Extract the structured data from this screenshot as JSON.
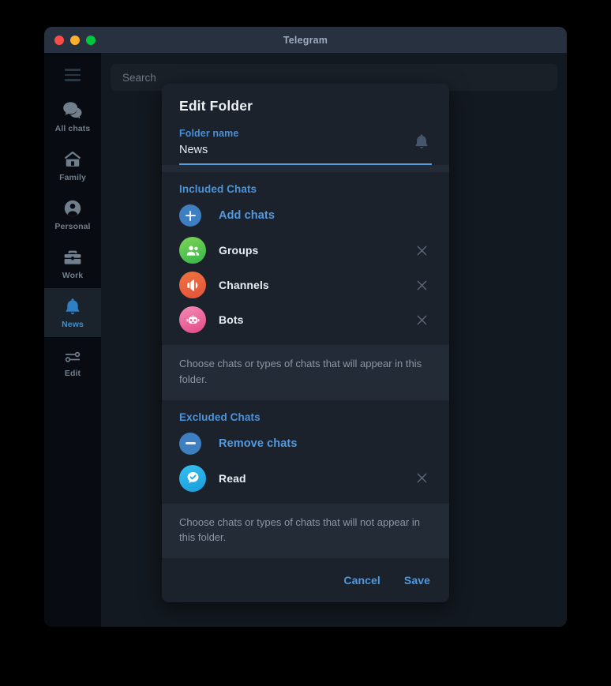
{
  "window": {
    "title": "Telegram",
    "controls": [
      "close",
      "minimize",
      "maximize"
    ]
  },
  "sidebar": {
    "menu_icon": "hamburger-icon",
    "items": [
      {
        "label": "All chats",
        "icon": "chats-icon",
        "active": false
      },
      {
        "label": "Family",
        "icon": "home-icon",
        "active": false
      },
      {
        "label": "Personal",
        "icon": "person-icon",
        "active": false
      },
      {
        "label": "Work",
        "icon": "briefcase-icon",
        "active": false
      },
      {
        "label": "News",
        "icon": "bell-icon",
        "active": true
      },
      {
        "label": "Edit",
        "icon": "sliders-icon",
        "active": false
      }
    ]
  },
  "search": {
    "placeholder": "Search",
    "value": ""
  },
  "dialog": {
    "title": "Edit Folder",
    "folder_name_label": "Folder name",
    "folder_name_value": "News",
    "notification_icon": "bell-icon",
    "included": {
      "section_title": "Included Chats",
      "add_label": "Add chats",
      "add_icon": "plus-icon",
      "chats": [
        {
          "name": "Groups",
          "icon": "group-icon",
          "color": "#4cc05a"
        },
        {
          "name": "Channels",
          "icon": "megaphone-icon",
          "color": "#e85f3c"
        },
        {
          "name": "Bots",
          "icon": "robot-icon",
          "color": "#e8639a"
        }
      ],
      "hint": "Choose chats or types of chats that will appear in this folder."
    },
    "excluded": {
      "section_title": "Excluded Chats",
      "remove_label": "Remove chats",
      "remove_icon": "minus-icon",
      "chats": [
        {
          "name": "Read",
          "icon": "read-check-icon",
          "color": "#23a8e0"
        }
      ],
      "hint": "Choose chats or types of chats that will not appear in this folder."
    },
    "cancel_label": "Cancel",
    "save_label": "Save"
  },
  "colors": {
    "accent": "#4b93da",
    "dialog_bg": "#1b222c",
    "hint_bg": "#222b36",
    "sidebar_bg": "#080b12",
    "titlebar_bg": "#28313f"
  }
}
